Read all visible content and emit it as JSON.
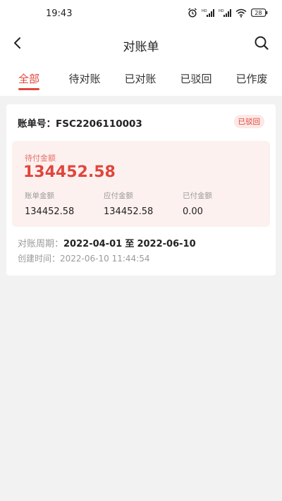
{
  "status_bar": {
    "time": "19:43",
    "battery": "28",
    "icons": [
      "alarm-icon",
      "signal-hd-icon",
      "signal-hd-icon",
      "wifi-icon",
      "battery-icon"
    ]
  },
  "nav": {
    "title": "对账单",
    "back_icon": "chevron-left-icon",
    "search_icon": "search-icon"
  },
  "tabs": [
    {
      "label": "全部",
      "active": true
    },
    {
      "label": "待对账",
      "active": false
    },
    {
      "label": "已对账",
      "active": false
    },
    {
      "label": "已驳回",
      "active": false
    },
    {
      "label": "已作废",
      "active": false
    }
  ],
  "card": {
    "bill_no_label": "账单号：",
    "bill_no": "FSC2206110003",
    "status": "已驳回",
    "due_label": "待付金额",
    "due_value": "134452.58",
    "sub_amounts": [
      {
        "label": "账单金额",
        "value": "134452.58"
      },
      {
        "label": "应付金额",
        "value": "134452.58"
      },
      {
        "label": "已付金额",
        "value": "0.00"
      }
    ],
    "period_label": "对账周期：",
    "period_start": "2022-04-01",
    "period_sep": "至",
    "period_end": "2022-06-10",
    "created_label": "创建时间：",
    "created_value": "2022-06-10 11:44:54"
  },
  "colors": {
    "accent": "#e0463c",
    "badge_bg": "#fde8e6",
    "amount_bg": "#fdf1f0",
    "page_bg": "#f2f2f2"
  }
}
